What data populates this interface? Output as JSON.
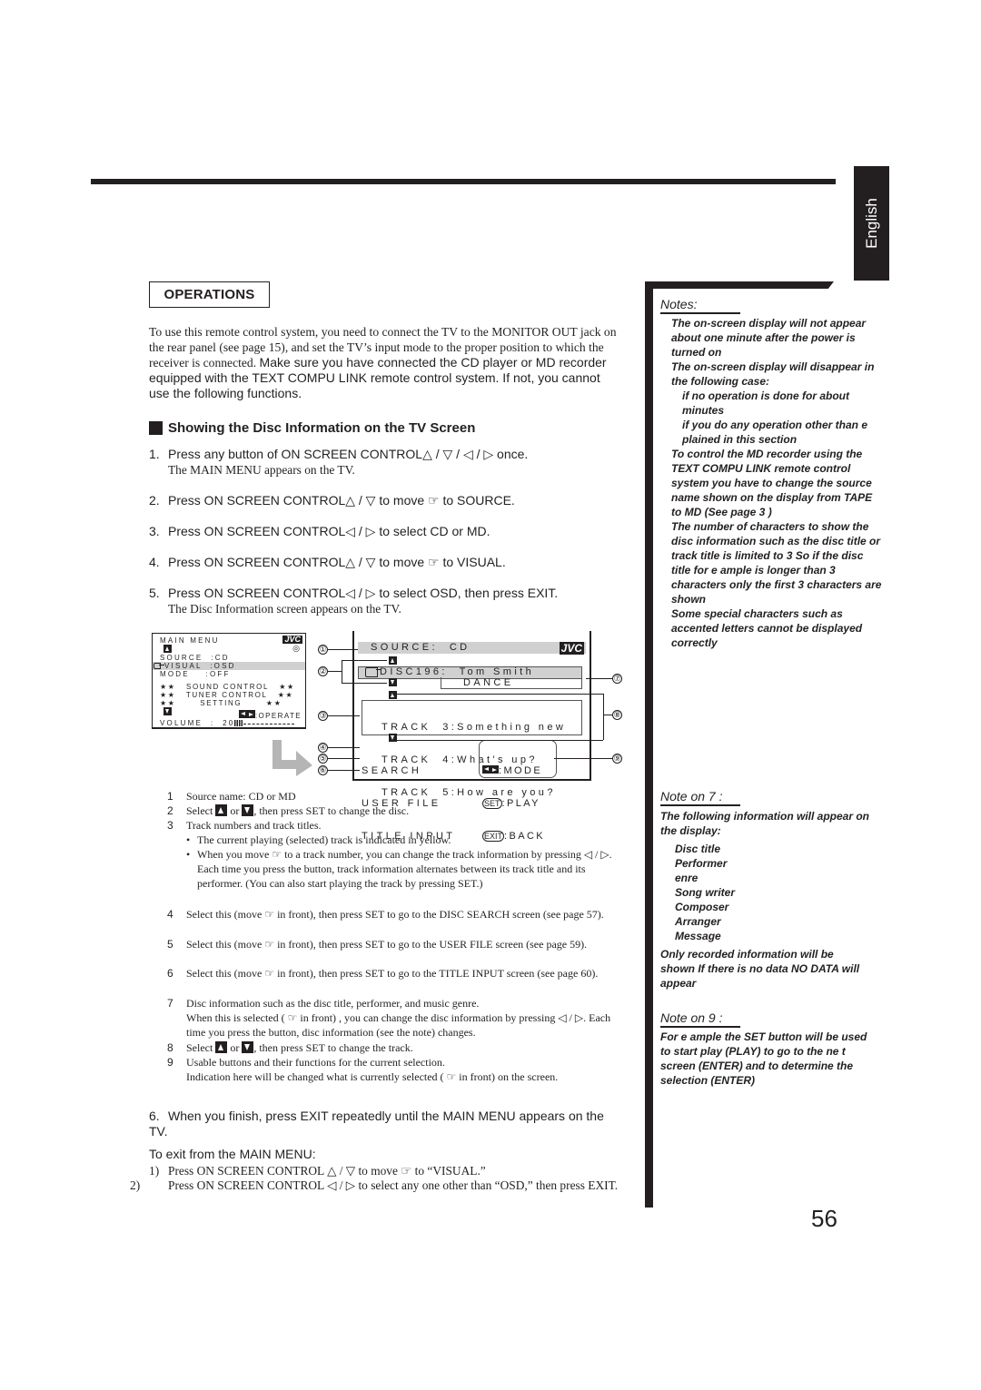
{
  "language_tab": "English",
  "section_box": "OPERATIONS",
  "intro": {
    "serif_part": "To use this remote control system, you need to connect the TV to the MONITOR OUT jack on the rear panel (see page 15), and set the TV’s input mode to the proper position to which the receiver is connected.",
    "sans_part": "Make sure you have connected the CD player or MD recorder equipped with the TEXT COMPU LINK remote control system. If not, you cannot use the following functions."
  },
  "heading": "Showing the Disc Information on the TV Screen",
  "steps": [
    {
      "num": "1.",
      "text": "Press any button of ON SCREEN CONTROL△ / ▽ / ◁ / ▷ once.",
      "sub": "The MAIN MENU appears on the TV."
    },
    {
      "num": "2.",
      "text": "Press ON SCREEN CONTROL△ / ▽ to move ☞ to  SOURCE."
    },
    {
      "num": "3.",
      "text": "Press ON SCREEN CONTROL◁ / ▷ to select  CD  or  MD."
    },
    {
      "num": "4.",
      "text": "Press ON SCREEN CONTROL△ / ▽ to move ☞ to  VISUAL."
    },
    {
      "num": "5.",
      "text": "Press ON SCREEN CONTROL◁ / ▷ to select  OSD,  then press EXIT.",
      "sub": "The Disc Information screen appears on the TV."
    },
    {
      "num": "6.",
      "text": "When you finish, press EXIT repeatedly until the MAIN MENU appears on the TV."
    }
  ],
  "main_menu_screen": {
    "title": "MAIN MENU",
    "logo": "JVC",
    "rows": [
      {
        "label": "SOURCE",
        "value": ":CD"
      },
      {
        "label": "VISUAL",
        "value": ":OSD",
        "selected": true
      },
      {
        "label": "MODE",
        "value": ":OFF"
      }
    ],
    "submenus": [
      "★★   SOUND CONTROL   ★★",
      "★★   TUNER CONTROL   ★★",
      "★★       SETTING       ★★"
    ],
    "operate_hint": ":OPERATE",
    "volume_label": "VOLUME  :  20",
    "volume_level": 20
  },
  "disc_info_screen": {
    "source": "SOURCE:  CD",
    "logo": "JVC",
    "disc_line": "DISC196:  Tom Smith",
    "disc_info": "DANCE",
    "tracks": [
      "TRACK  3:Something new",
      "TRACK  4:What's up?",
      "TRACK  5:How are you?"
    ],
    "menu_items": [
      "SEARCH",
      "USER FILE",
      "TITLE INPUT"
    ],
    "button_hints": [
      {
        "button": "◀▶",
        "action": ":MODE"
      },
      {
        "button": "SET",
        "action": ":PLAY"
      },
      {
        "button": "EXIT",
        "action": ":BACK"
      }
    ],
    "callouts": [
      "①",
      "②",
      "③",
      "④",
      "⑤",
      "⑥",
      "⑦",
      "⑧",
      "⑨"
    ]
  },
  "legend": [
    {
      "num": "1",
      "text": "Source name: CD or MD"
    },
    {
      "num": "2",
      "text_a": "Select",
      "text_b": "or",
      "text_c": ", then press SET to change the disc."
    },
    {
      "num": "3",
      "text": "Track numbers and track titles.",
      "bullets": [
        "The current playing (selected) track is indicated in yellow.",
        "When you move ☞ to a track number, you can change the track information by pressing ◁ / ▷. Each time you press the button, track information alternates between its track title and its performer. (You can also start playing the track by pressing SET.)"
      ]
    },
    {
      "num": "4",
      "text": "Select this (move ☞ in front), then press SET to go to the DISC SEARCH screen (see page 57)."
    },
    {
      "num": "5",
      "text": "Select this (move ☞ in front), then press SET to go to the USER FILE screen (see page 59)."
    },
    {
      "num": "6",
      "text": "Select this (move ☞ in front), then press SET to go to the TITLE INPUT screen (see page 60)."
    },
    {
      "num": "7",
      "text": "Disc information such as the disc title, performer, and music genre.",
      "text2": "When this is selected ( ☞ in front) , you can change the disc information by pressing ◁ / ▷. Each time you press the button, disc information (see the note) changes."
    },
    {
      "num": "8",
      "text_a": "Select",
      "text_b": "or",
      "text_c": ", then press SET to change the track."
    },
    {
      "num": "9",
      "text": "Usable buttons and their functions for the current selection.",
      "text2": "Indication here will be changed what is currently selected ( ☞ in front) on the screen."
    }
  ],
  "exit_section": {
    "title": "To exit from the MAIN MENU:",
    "items": [
      {
        "num": "1)",
        "text": "Press ON SCREEN CONTROL △ / ▽ to move ☞ to “VISUAL.”"
      },
      {
        "num": "2)",
        "text": "Press ON SCREEN CONTROL ◁ / ▷ to select any one other than “OSD,” then press EXIT."
      }
    ]
  },
  "notes": {
    "title": "Notes:",
    "items": [
      "The on-screen display will not appear about one minute after the power is turned on",
      "The on-screen display will disappear in the following case:",
      "if no operation is done for about    minutes",
      "if you do any operation other than e plained in this section",
      "To control the MD recorder using the TEXT COMPU LINK remote control system  you have to change the source name shown on the display from  TAPE  to  MD  (See page   3 )",
      "The number of characters to show the disc information such as the disc title or track title is limited to 3    So if the disc title  for e ample  is longer than 3   characters only the first 3   characters are shown",
      "Some special characters such as accented letters cannot be displayed correctly"
    ]
  },
  "note7": {
    "title": "Note on  7  :",
    "intro": "The following information will appear on the display:",
    "list": [
      "Disc title",
      "Performer",
      "  enre",
      "Song writer",
      "Composer",
      "Arranger",
      "Message"
    ],
    "outro": "Only recorded information will be shown  If there is no data  NO DATA  will appear"
  },
  "note9": {
    "title": "Note on  9  :",
    "text": "For e ample  the SET button will be used to start play (PLAY)  to go to the ne t screen (ENTER) and to determine the selection (ENTER)"
  },
  "page_number": "56"
}
